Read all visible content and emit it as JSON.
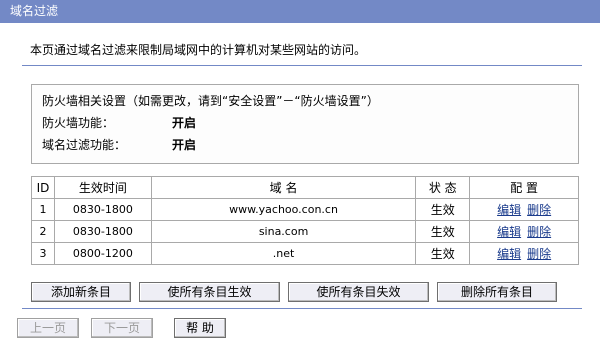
{
  "window": {
    "title": "域名过滤"
  },
  "intro": "本页通过域名过滤来限制局域网中的计算机对某些网站的访问。",
  "firewall": {
    "hint": "防火墙相关设置（如需更改，请到“安全设置”－“防火墙设置”）",
    "rows": [
      {
        "label": "防火墙功能：",
        "value": "开启"
      },
      {
        "label": "域名过滤功能：",
        "value": "开启"
      }
    ]
  },
  "table": {
    "headers": [
      "ID",
      "生效时间",
      "域 名",
      "状 态",
      "配 置"
    ],
    "rows": [
      {
        "id": "1",
        "time": "0830-1800",
        "domain": "www.yachoo.con.cn",
        "status": "生效"
      },
      {
        "id": "2",
        "time": "0830-1800",
        "domain": "sina.com",
        "status": "生效"
      },
      {
        "id": "3",
        "time": "0800-1200",
        "domain": ".net",
        "status": "生效"
      }
    ],
    "edit_label": "编辑",
    "delete_label": "删除"
  },
  "actions": {
    "add": "添加新条目",
    "enable_all": "使所有条目生效",
    "disable_all": "使所有条目失效",
    "delete_all": "删除所有条目"
  },
  "nav": {
    "prev": "上一页",
    "next": "下一页",
    "help": "帮 助"
  }
}
